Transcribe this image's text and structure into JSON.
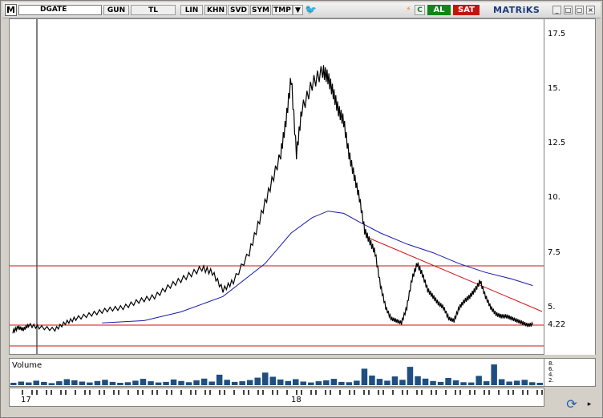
{
  "toolbar": {
    "logo": "M",
    "symbol": "DGATE",
    "buttons": [
      "GUN",
      "TL",
      "LIN",
      "KHN",
      "SVD",
      "SYM",
      "TMP"
    ],
    "dropdown_icon": "triangle-down-icon",
    "twitter_icon": "twitter-icon",
    "buy_label": "AL",
    "sell_label": "SAT",
    "brand": "MATRiKS"
  },
  "price_axis": {
    "ticks": [
      "17.5",
      "15.",
      "12.5",
      "10.",
      "7.5",
      "5.",
      "4.22"
    ]
  },
  "volume_panel": {
    "title": "Volume",
    "ticks": [
      "8.",
      "6.",
      "4.",
      "2."
    ]
  },
  "time_axis": {
    "labels": [
      "17",
      "18"
    ]
  },
  "chart_data": {
    "type": "line",
    "y_range": [
      3.2,
      18.0
    ],
    "current_value": 4.22,
    "price_series": [
      [
        0,
        3.9
      ],
      [
        1,
        4.1
      ],
      [
        2,
        4.0
      ],
      [
        3,
        4.2
      ],
      [
        5,
        4.1
      ],
      [
        8,
        4.0
      ],
      [
        10,
        4.3
      ],
      [
        12,
        4.5
      ],
      [
        15,
        4.7
      ],
      [
        18,
        4.9
      ],
      [
        21,
        5.0
      ],
      [
        24,
        5.3
      ],
      [
        27,
        5.5
      ],
      [
        30,
        6.0
      ],
      [
        33,
        6.4
      ],
      [
        36,
        6.8
      ],
      [
        38,
        6.6
      ],
      [
        40,
        5.8
      ],
      [
        42,
        6.2
      ],
      [
        45,
        7.5
      ],
      [
        47,
        9.0
      ],
      [
        49,
        10.5
      ],
      [
        51,
        12.0
      ],
      [
        52,
        13.5
      ],
      [
        53,
        15.5
      ],
      [
        54,
        12.0
      ],
      [
        55,
        14.0
      ],
      [
        57,
        15.2
      ],
      [
        59,
        15.8
      ],
      [
        60,
        15.5
      ],
      [
        61,
        14.8
      ],
      [
        62,
        14.0
      ],
      [
        63,
        13.5
      ],
      [
        64,
        12.0
      ],
      [
        65,
        11.0
      ],
      [
        66,
        10.0
      ],
      [
        67,
        8.5
      ],
      [
        68,
        8.0
      ],
      [
        69,
        7.5
      ],
      [
        70,
        6.0
      ],
      [
        71,
        5.0
      ],
      [
        72,
        4.5
      ],
      [
        73,
        4.4
      ],
      [
        74,
        4.3
      ],
      [
        75,
        5.0
      ],
      [
        76,
        6.3
      ],
      [
        77,
        7.0
      ],
      [
        78,
        6.5
      ],
      [
        79,
        5.8
      ],
      [
        80,
        5.5
      ],
      [
        81,
        5.2
      ],
      [
        82,
        5.0
      ],
      [
        83,
        4.5
      ],
      [
        84,
        4.4
      ],
      [
        85,
        5.0
      ],
      [
        86,
        5.3
      ],
      [
        87,
        5.5
      ],
      [
        88,
        5.8
      ],
      [
        89,
        6.2
      ],
      [
        90,
        5.5
      ],
      [
        91,
        5.0
      ],
      [
        92,
        4.7
      ],
      [
        93,
        4.6
      ],
      [
        94,
        4.6
      ],
      [
        95,
        4.5
      ],
      [
        96,
        4.4
      ],
      [
        97,
        4.3
      ],
      [
        98,
        4.2
      ],
      [
        99,
        4.22
      ]
    ],
    "moving_average": [
      [
        17,
        4.3
      ],
      [
        25,
        4.4
      ],
      [
        32,
        4.8
      ],
      [
        40,
        5.5
      ],
      [
        48,
        7.0
      ],
      [
        53,
        8.4
      ],
      [
        57,
        9.1
      ],
      [
        60,
        9.4
      ],
      [
        63,
        9.3
      ],
      [
        66,
        8.9
      ],
      [
        70,
        8.4
      ],
      [
        75,
        7.9
      ],
      [
        80,
        7.5
      ],
      [
        85,
        7.0
      ],
      [
        90,
        6.6
      ],
      [
        95,
        6.3
      ],
      [
        99,
        6.0
      ]
    ],
    "volume": [
      0.8,
      1.2,
      0.9,
      1.5,
      1.1,
      0.7,
      1.3,
      2.0,
      1.6,
      1.2,
      0.9,
      1.4,
      1.8,
      1.1,
      0.8,
      1.0,
      1.5,
      2.1,
      1.3,
      0.9,
      1.1,
      1.9,
      1.4,
      1.0,
      1.6,
      2.2,
      1.2,
      3.5,
      1.8,
      1.1,
      1.3,
      1.7,
      2.5,
      4.2,
      2.8,
      1.9,
      1.4,
      2.0,
      1.2,
      0.9,
      1.3,
      1.6,
      2.1,
      1.1,
      1.0,
      1.5,
      5.5,
      3.2,
      2.1,
      1.5,
      2.9,
      1.8,
      6.1,
      3.0,
      2.2,
      1.4,
      1.1,
      2.4,
      1.6,
      1.0,
      0.9,
      3.1,
      1.3,
      6.9,
      2.0,
      1.2,
      1.5,
      1.8,
      1.0,
      0.8
    ]
  },
  "colors": {
    "price_line": "#000000",
    "moving_average": "#1a1aa8",
    "support_resistance": "#d01010",
    "volume_bars": "#1f4f80",
    "buy": "#11841a",
    "sell": "#c4140e"
  },
  "corner_icons": [
    "refresh-icon"
  ]
}
